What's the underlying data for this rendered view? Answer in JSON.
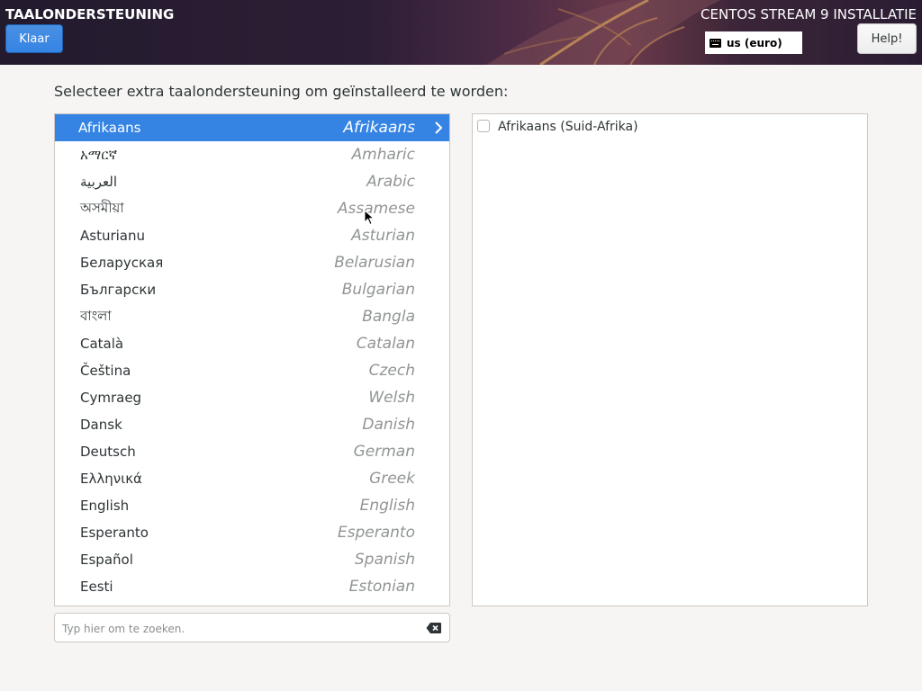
{
  "header": {
    "spoke_title": "TAALONDERSTEUNING",
    "done_label": "Klaar",
    "product_title": "CENTOS STREAM 9 INSTALLATIE",
    "keyboard_layout": "us (euro)",
    "help_label": "Help!"
  },
  "prompt": "Selecteer extra taalondersteuning om geïnstalleerd te worden:",
  "languages": [
    {
      "native": "Afrikaans",
      "english": "Afrikaans",
      "selected": true
    },
    {
      "native": "አማርኛ",
      "english": "Amharic"
    },
    {
      "native": "العربية",
      "english": "Arabic"
    },
    {
      "native": "অসমীয়া",
      "english": "Assamese"
    },
    {
      "native": "Asturianu",
      "english": "Asturian"
    },
    {
      "native": "Беларуская",
      "english": "Belarusian"
    },
    {
      "native": "Български",
      "english": "Bulgarian"
    },
    {
      "native": "বাংলা",
      "english": "Bangla"
    },
    {
      "native": "Català",
      "english": "Catalan"
    },
    {
      "native": "Čeština",
      "english": "Czech"
    },
    {
      "native": "Cymraeg",
      "english": "Welsh"
    },
    {
      "native": "Dansk",
      "english": "Danish"
    },
    {
      "native": "Deutsch",
      "english": "German"
    },
    {
      "native": "Ελληνικά",
      "english": "Greek"
    },
    {
      "native": "English",
      "english": "English"
    },
    {
      "native": "Esperanto",
      "english": "Esperanto"
    },
    {
      "native": "Español",
      "english": "Spanish"
    },
    {
      "native": "Eesti",
      "english": "Estonian"
    }
  ],
  "locales": [
    {
      "label": "Afrikaans (Suid-Afrika)",
      "checked": false
    }
  ],
  "search": {
    "placeholder": "Typ hier om te zoeken."
  },
  "colors": {
    "accent": "#3584e4",
    "background": "#f6f5f4"
  }
}
